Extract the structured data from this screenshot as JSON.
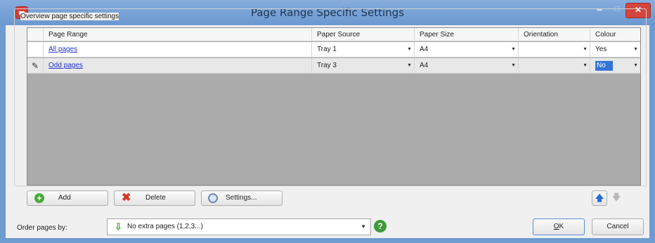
{
  "window": {
    "title": "Page Range Specific Settings",
    "minimize_glyph": "–",
    "maximize_glyph": "□",
    "close_glyph": "✕"
  },
  "group": {
    "label": "Overview page specific settings"
  },
  "grid": {
    "columns": [
      "Page Range",
      "Paper Source",
      "Paper Size",
      "Orientation",
      "Colour"
    ],
    "rows": [
      {
        "page_range": "All pages",
        "paper_source": "Tray 1",
        "paper_size": "A4",
        "orientation": "",
        "colour": "Yes",
        "selected": false,
        "indicator": ""
      },
      {
        "page_range": "Odd pages",
        "paper_source": "Tray 3",
        "paper_size": "A4",
        "orientation": "",
        "colour": "No",
        "selected": true,
        "indicator": "✎"
      }
    ]
  },
  "buttons": {
    "add": "Add",
    "delete": "Delete",
    "settings": "Settings...",
    "ok_underline": "O",
    "ok_rest": "K",
    "cancel": "Cancel"
  },
  "order": {
    "label": "Order pages by:",
    "selected": "No extra pages (1,2,3...)"
  },
  "icons": {
    "add": "plus-icon",
    "delete": "x-icon",
    "settings": "gear-icon",
    "move_up": "arrow-up-icon",
    "move_down": "arrow-down-icon",
    "help": "help-icon"
  },
  "colors": {
    "titlebar": "#6e9bd0",
    "close_button": "#d4453c",
    "selection": "#3375d8",
    "link": "#2233cc",
    "grid_background": "#ababab"
  }
}
